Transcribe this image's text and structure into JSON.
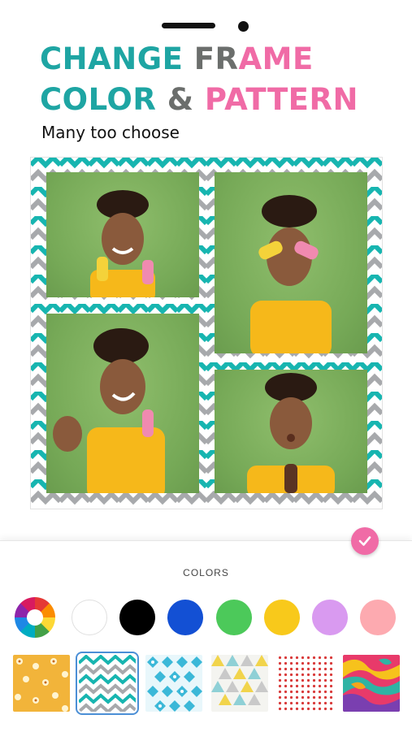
{
  "status_bar": {},
  "headline": {
    "line1_part1": "CHANGE",
    "line1_part2": "FR",
    "line1_part3": "AME",
    "line2_part1": "COLOR",
    "line2_part2": "&",
    "line2_part3": "PATTERN",
    "colors": {
      "teal": "#1ea5a3",
      "gray": "#6b6e6c",
      "pink": "#f06ba6"
    }
  },
  "subtitle": "Many too choose",
  "frame": {
    "pattern": "chevron",
    "colors": {
      "teal": "#17b5b0",
      "gray": "#a7a9ac",
      "white": "#ffffff"
    },
    "photos": [
      {
        "name": "photo-woman-two-popsicles-smiling"
      },
      {
        "name": "photo-woman-popsicles-over-eyes"
      },
      {
        "name": "photo-woman-laughing-waving"
      },
      {
        "name": "photo-woman-surprised-popsicle"
      }
    ]
  },
  "panel": {
    "confirm_icon": "checkmark-icon",
    "section_title": "COLORS",
    "color_swatches": [
      {
        "name": "color-wheel-icon",
        "color": "multicolor"
      },
      {
        "name": "white",
        "color": "#ffffff"
      },
      {
        "name": "black",
        "color": "#000000"
      },
      {
        "name": "blue",
        "color": "#1350d4"
      },
      {
        "name": "green",
        "color": "#4cc95a"
      },
      {
        "name": "yellow",
        "color": "#f8c91b"
      },
      {
        "name": "lilac",
        "color": "#d99af0"
      },
      {
        "name": "pink",
        "color": "#fdaab0"
      }
    ],
    "patterns": [
      {
        "name": "pattern-yellow-floral",
        "selected": false
      },
      {
        "name": "pattern-teal-chevron",
        "selected": true
      },
      {
        "name": "pattern-blue-diamonds",
        "selected": false
      },
      {
        "name": "pattern-colored-triangles",
        "selected": false
      },
      {
        "name": "pattern-red-dots",
        "selected": false
      },
      {
        "name": "pattern-colorful-waves",
        "selected": false
      }
    ]
  }
}
